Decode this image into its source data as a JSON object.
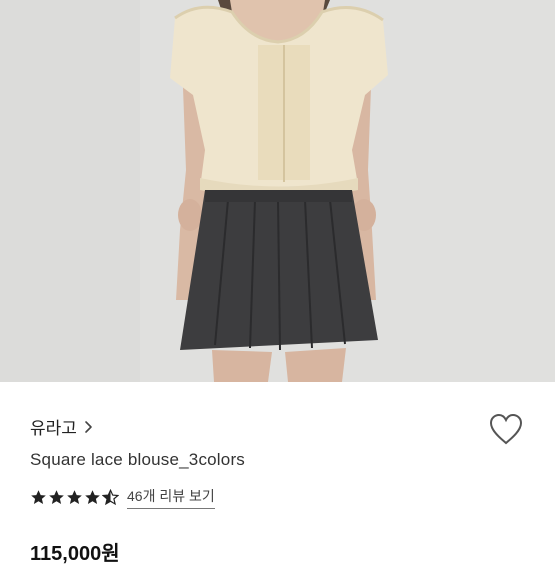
{
  "product": {
    "image_alt": "model wearing cream square-neck lace blouse with dark grey pleated skirt",
    "seller_name": "유라고",
    "title": "Square lace blouse_3colors",
    "rating": 4.5,
    "rating_max": 5,
    "review_link": "46개 리뷰 보기",
    "price": "115,000원"
  },
  "icons": {
    "chevron": "chevron-right-icon",
    "heart": "heart-outline-icon",
    "star_full": "star-filled-icon",
    "star_half": "star-half-icon"
  },
  "colors": {
    "star": "#222222",
    "heart_stroke": "#555555"
  }
}
